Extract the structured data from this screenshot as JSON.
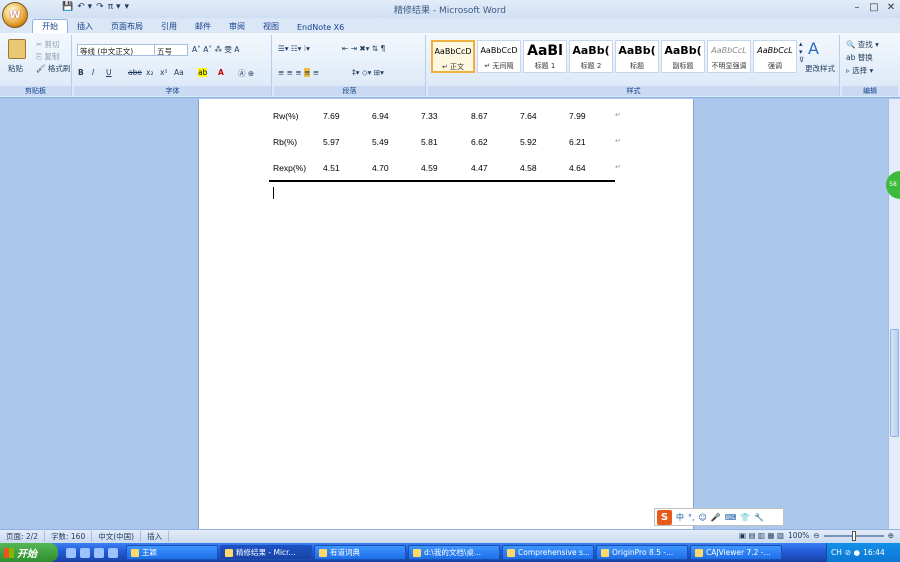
{
  "window": {
    "title": "精修结果 - Microsoft Word"
  },
  "qat": [
    "💾",
    "↶ ▾",
    "↷",
    "π ▾",
    "▾"
  ],
  "tabs": [
    "开始",
    "插入",
    "页面布局",
    "引用",
    "邮件",
    "审阅",
    "视图",
    "EndNote X6"
  ],
  "clipboard": {
    "paste": "粘贴",
    "cut": "剪切",
    "copy": "复制",
    "format_painter": "格式刷",
    "label": "剪贴板"
  },
  "font": {
    "name": "等线 (中文正文)",
    "size": "五号",
    "label": "字体",
    "buttons": [
      "B",
      "I",
      "U",
      "abe",
      "x₂",
      "x²",
      "Aa",
      "A"
    ]
  },
  "paragraph": {
    "label": "段落"
  },
  "styles": {
    "label": "样式",
    "items": [
      {
        "sample": "AaBbCcD",
        "name": "↵ 正文"
      },
      {
        "sample": "AaBbCcD",
        "name": "↵ 无间隔"
      },
      {
        "sample": "AaBl",
        "name": "标题 1"
      },
      {
        "sample": "AaBb(",
        "name": "标题 2"
      },
      {
        "sample": "AaBb(",
        "name": "标题"
      },
      {
        "sample": "AaBb(",
        "name": "副标题"
      },
      {
        "sample": "AaBbCcL",
        "name": "不明显强调"
      },
      {
        "sample": "AaBbCcL",
        "name": "强调"
      }
    ],
    "change": "更改样式"
  },
  "editing": {
    "label": "编辑",
    "find": "查找 ▾",
    "replace": "替换",
    "select": "选择 ▾"
  },
  "table": {
    "rows": [
      {
        "label": "Rw(%)",
        "values": [
          "7.69",
          "6.94",
          "7.33",
          "8.67",
          "7.64",
          "7.99"
        ]
      },
      {
        "label": "Rb(%)",
        "values": [
          "5.97",
          "5.49",
          "5.81",
          "6.62",
          "5.92",
          "6.21"
        ]
      },
      {
        "label": "Rexp(%)",
        "values": [
          "4.51",
          "4.70",
          "4.59",
          "4.47",
          "4.58",
          "4.64"
        ]
      }
    ]
  },
  "status": {
    "page": "页面: 2/2",
    "words": "字数: 160",
    "lang": "中文(中国)",
    "mode": "插入",
    "zoom": "100%"
  },
  "ime": {
    "logo": "S",
    "items": [
      "中",
      "°,",
      "☺",
      "🎤",
      "⌨",
      "👕",
      "🔧"
    ]
  },
  "taskbar": {
    "start": "开始",
    "tasks": [
      "王颖",
      "精修结果 - Micr...",
      "有道词典",
      "d:\\我的文档\\桌...",
      "Comprehensive s...",
      "OriginPro 8.5 -...",
      "CAJViewer 7.2 -..."
    ],
    "tray_lang": "CH",
    "clock": "16:44"
  },
  "side_badge": "58"
}
